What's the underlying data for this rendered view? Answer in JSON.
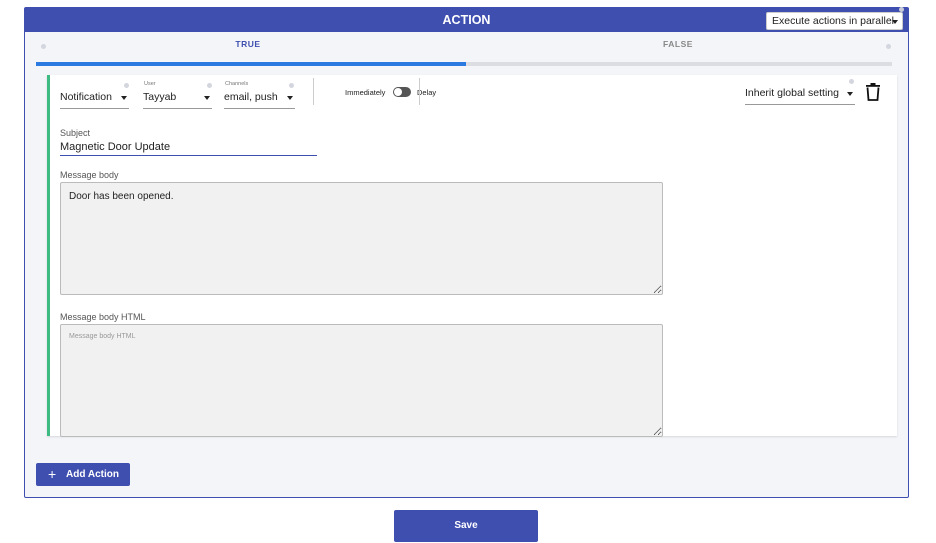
{
  "header": {
    "title": "ACTION",
    "mode_select": "Execute actions in parallel"
  },
  "tabs": [
    {
      "label": "TRUE",
      "active": true
    },
    {
      "label": "FALSE",
      "active": false
    }
  ],
  "action": {
    "type": {
      "value": "Notification"
    },
    "user": {
      "label": "User",
      "value": "Tayyab"
    },
    "channels": {
      "label": "Channels",
      "value": "email, push"
    },
    "timing": {
      "immediately_label": "Immediately",
      "delay_label": "Delay"
    },
    "global_setting": "Inherit global setting",
    "subject": {
      "label": "Subject",
      "value": "Magnetic Door Update"
    },
    "message_body": {
      "label": "Message body",
      "value": "Door has been opened."
    },
    "message_body_html": {
      "label": "Message body HTML",
      "placeholder": "Message body HTML"
    }
  },
  "buttons": {
    "add_action": "Add Action",
    "add_icon": "+",
    "save": "Save"
  },
  "colors": {
    "primary": "#3f4fb0",
    "accent_blue": "#2a7ae2",
    "success_green": "#3dbb82",
    "panel_bg": "#f4f5f9"
  }
}
